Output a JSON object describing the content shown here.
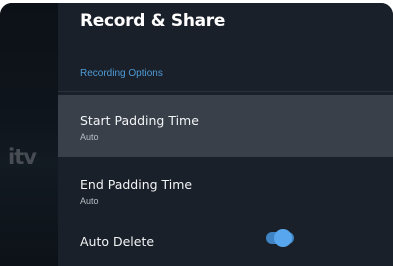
{
  "background": {
    "logo_text": "itv"
  },
  "panel": {
    "title": "Record & Share",
    "section_label": "Recording Options",
    "items": [
      {
        "label": "Start Padding Time",
        "value": "Auto"
      },
      {
        "label": "End Padding Time",
        "value": "Auto"
      },
      {
        "label": "Auto Delete",
        "toggle_on": true
      }
    ]
  },
  "colors": {
    "accent": "#4f9bd8",
    "panel_bg": "#1a2029",
    "focused_bg": "#39404a",
    "toggle_on": "#58a6ee"
  }
}
